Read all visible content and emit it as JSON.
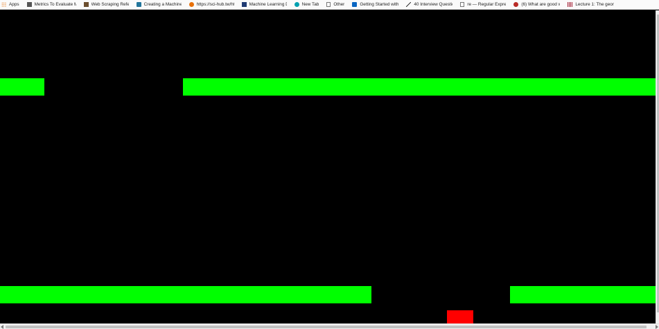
{
  "bookmarks": [
    {
      "label": "Apps",
      "icon": "apps-grid-icon",
      "color": "#e8710a"
    },
    {
      "label": "Metrics To Evaluate M",
      "icon": "site-favicon-icon",
      "color": "#555555"
    },
    {
      "label": "Web Scraping Refere",
      "icon": "site-favicon-icon",
      "color": "#6b4e2e"
    },
    {
      "label": "Creating a Machine L",
      "icon": "wordpress-icon",
      "color": "#21759b"
    },
    {
      "label": "https://sci-hub.tw/ht",
      "icon": "sci-hub-icon",
      "color": "#e8710a"
    },
    {
      "label": "Machine Learning Di",
      "icon": "site-favicon-icon",
      "color": "#1f3b73"
    },
    {
      "label": "New Tab",
      "icon": "globe-icon",
      "color": "#00a0b0"
    },
    {
      "label": "Other",
      "icon": "page-icon",
      "color": "#777777"
    },
    {
      "label": "Getting Started with",
      "icon": "linkedin-icon",
      "color": "#0a66c2"
    },
    {
      "label": "40 Interview Questio",
      "icon": "chart-icon",
      "color": "#333333"
    },
    {
      "label": "re — Regular Expressi",
      "icon": "page-icon",
      "color": "#777777"
    },
    {
      "label": "(6) What are good w",
      "icon": "quora-icon",
      "color": "#b92b27"
    },
    {
      "label": "Lecture 1: The geom",
      "icon": "mit-icon",
      "color": "#a31f34"
    }
  ],
  "colors": {
    "background": "#000000",
    "platform": "#00ff00",
    "player": "#ff0000"
  }
}
